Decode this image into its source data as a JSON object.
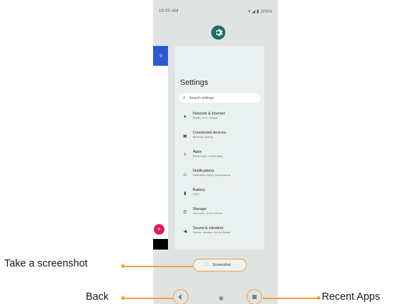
{
  "status_bar": {
    "time": "10:00 AM",
    "battery": "100%"
  },
  "settings": {
    "title": "Settings",
    "search_placeholder": "Search settings",
    "items": [
      {
        "icon": "wifi-icon",
        "title": "Network & internet",
        "subtitle": "Mobile, Wi-Fi, hotspot"
      },
      {
        "icon": "devices-icon",
        "title": "Connected devices",
        "subtitle": "Bluetooth, pairing"
      },
      {
        "icon": "apps-icon",
        "title": "Apps",
        "subtitle": "Recent apps, default apps"
      },
      {
        "icon": "bell-icon",
        "title": "Notifications",
        "subtitle": "Notification history, conversations"
      },
      {
        "icon": "battery-icon",
        "title": "Battery",
        "subtitle": "100%"
      },
      {
        "icon": "storage-icon",
        "title": "Storage",
        "subtitle": "20% used - 50.99 GB free"
      },
      {
        "icon": "volume-icon",
        "title": "Sound & vibration",
        "subtitle": "Volume, vibration, Do Not Disturb"
      }
    ]
  },
  "screenshot_button": {
    "label": "Screenshot"
  },
  "callouts": {
    "screenshot": "Take a screenshot",
    "back": "Back",
    "recent": "Recent Apps"
  },
  "colors": {
    "accent": "#f0a13b",
    "settings_icon_bg": "#1f6f6b",
    "fab": "#e4194f",
    "app_bar": "#2d55d6"
  }
}
